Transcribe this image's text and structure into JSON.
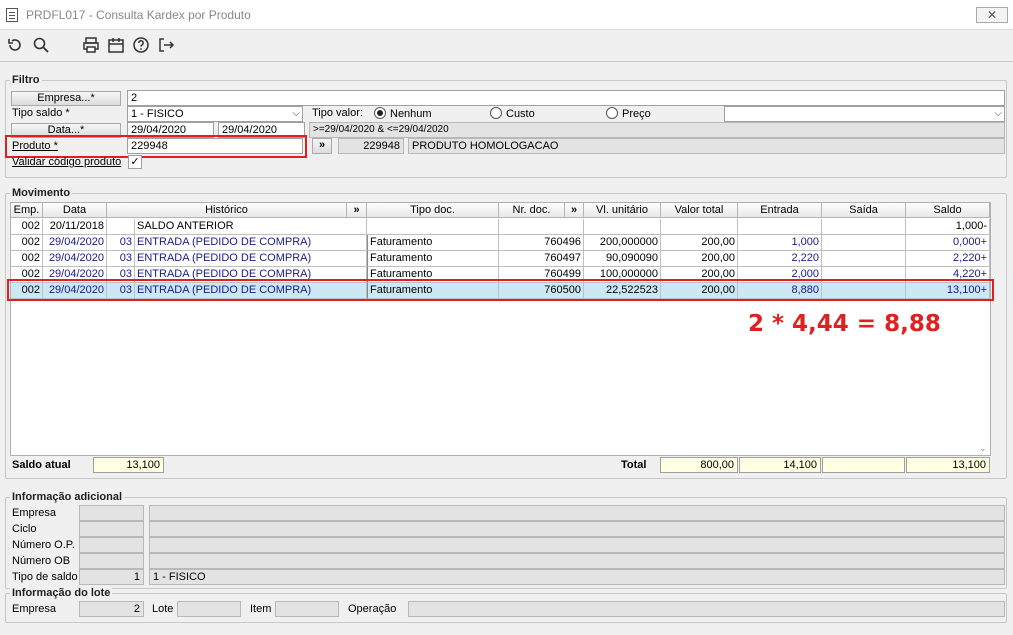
{
  "window": {
    "title": "PRDFL017 - Consulta Kardex por Produto",
    "close": "✕"
  },
  "toolbar": {
    "icons": [
      "undo-icon",
      "search-icon",
      "print-icon",
      "calendar-icon",
      "help-icon",
      "exit-icon"
    ]
  },
  "filtro": {
    "title": "Filtro",
    "empresa_label": "Empresa...*",
    "empresa_value": "2",
    "tipo_saldo_label": "Tipo saldo *",
    "tipo_saldo_value": "1 - FISICO",
    "tipo_valor_label": "Tipo valor:",
    "radio_nenhum": "Nenhum",
    "radio_custo": "Custo",
    "radio_preco": "Preço",
    "data_label": "Data...*",
    "data_inicio": "29/04/2020",
    "data_fim": "29/04/2020",
    "data_expr": ">=29/04/2020 & <=29/04/2020",
    "produto_label": "Produto *",
    "produto_value": "229948",
    "produto_btn": "»",
    "produto_code": "229948",
    "produto_desc": "PRODUTO HOMOLOGACAO",
    "validar_label": "Validar código produto",
    "validar_check": "✓"
  },
  "movimento": {
    "title": "Movimento",
    "headers": [
      "Emp.",
      "Data",
      "Histórico",
      "»",
      "Tipo doc.",
      "Nr. doc.",
      "»",
      "Vl. unitário",
      "Valor total",
      "Entrada",
      "Saída",
      "Saldo"
    ],
    "rows": [
      {
        "emp": "002",
        "data": "20/11/2018",
        "n": "",
        "hist": "SALDO ANTERIOR",
        "tipo": "",
        "nr": "",
        "vl": "",
        "total": "",
        "entrada": "",
        "saida": "",
        "saldo": "1,000-"
      },
      {
        "emp": "002",
        "data": "29/04/2020",
        "n": "03",
        "hist": "ENTRADA  (PEDIDO DE COMPRA)",
        "tipo": "Faturamento",
        "nr": "760496",
        "vl": "200,000000",
        "total": "200,00",
        "entrada": "1,000",
        "saida": "",
        "saldo": "0,000+"
      },
      {
        "emp": "002",
        "data": "29/04/2020",
        "n": "03",
        "hist": "ENTRADA  (PEDIDO DE COMPRA)",
        "tipo": "Faturamento",
        "nr": "760497",
        "vl": "90,090090",
        "total": "200,00",
        "entrada": "2,220",
        "saida": "",
        "saldo": "2,220+"
      },
      {
        "emp": "002",
        "data": "29/04/2020",
        "n": "03",
        "hist": "ENTRADA  (PEDIDO DE COMPRA)",
        "tipo": "Faturamento",
        "nr": "760499",
        "vl": "100,000000",
        "total": "200,00",
        "entrada": "2,000",
        "saida": "",
        "saldo": "4,220+"
      },
      {
        "emp": "002",
        "data": "29/04/2020",
        "n": "03",
        "hist": "ENTRADA  (PEDIDO DE COMPRA)",
        "tipo": "Faturamento",
        "nr": "760500",
        "vl": "22,522523",
        "total": "200,00",
        "entrada": "8,880",
        "saida": "",
        "saldo": "13,100+"
      }
    ],
    "annotation": "2 * 4,44 = 8,88",
    "saldo_atual_label": "Saldo atual",
    "saldo_atual_value": "13,100",
    "total_label": "Total",
    "total_valor": "800,00",
    "total_entrada": "14,100",
    "total_saida": "",
    "total_saldo": "13,100"
  },
  "info": {
    "title": "Informação adicional",
    "empresa": "Empresa",
    "ciclo": "Ciclo",
    "numero_op": "Número O.P.",
    "numero_ob": "Número OB",
    "tipo_saldo": "Tipo de saldo",
    "tipo_saldo_code": "1",
    "tipo_saldo_desc": "1 - FISICO"
  },
  "lote": {
    "title": "Informação do lote",
    "empresa": "Empresa",
    "empresa_value": "2",
    "lote": "Lote",
    "item": "Item",
    "operacao": "Operação"
  },
  "colors": {
    "highlight_row": "#cce8f4",
    "annotation": "#e02020"
  }
}
